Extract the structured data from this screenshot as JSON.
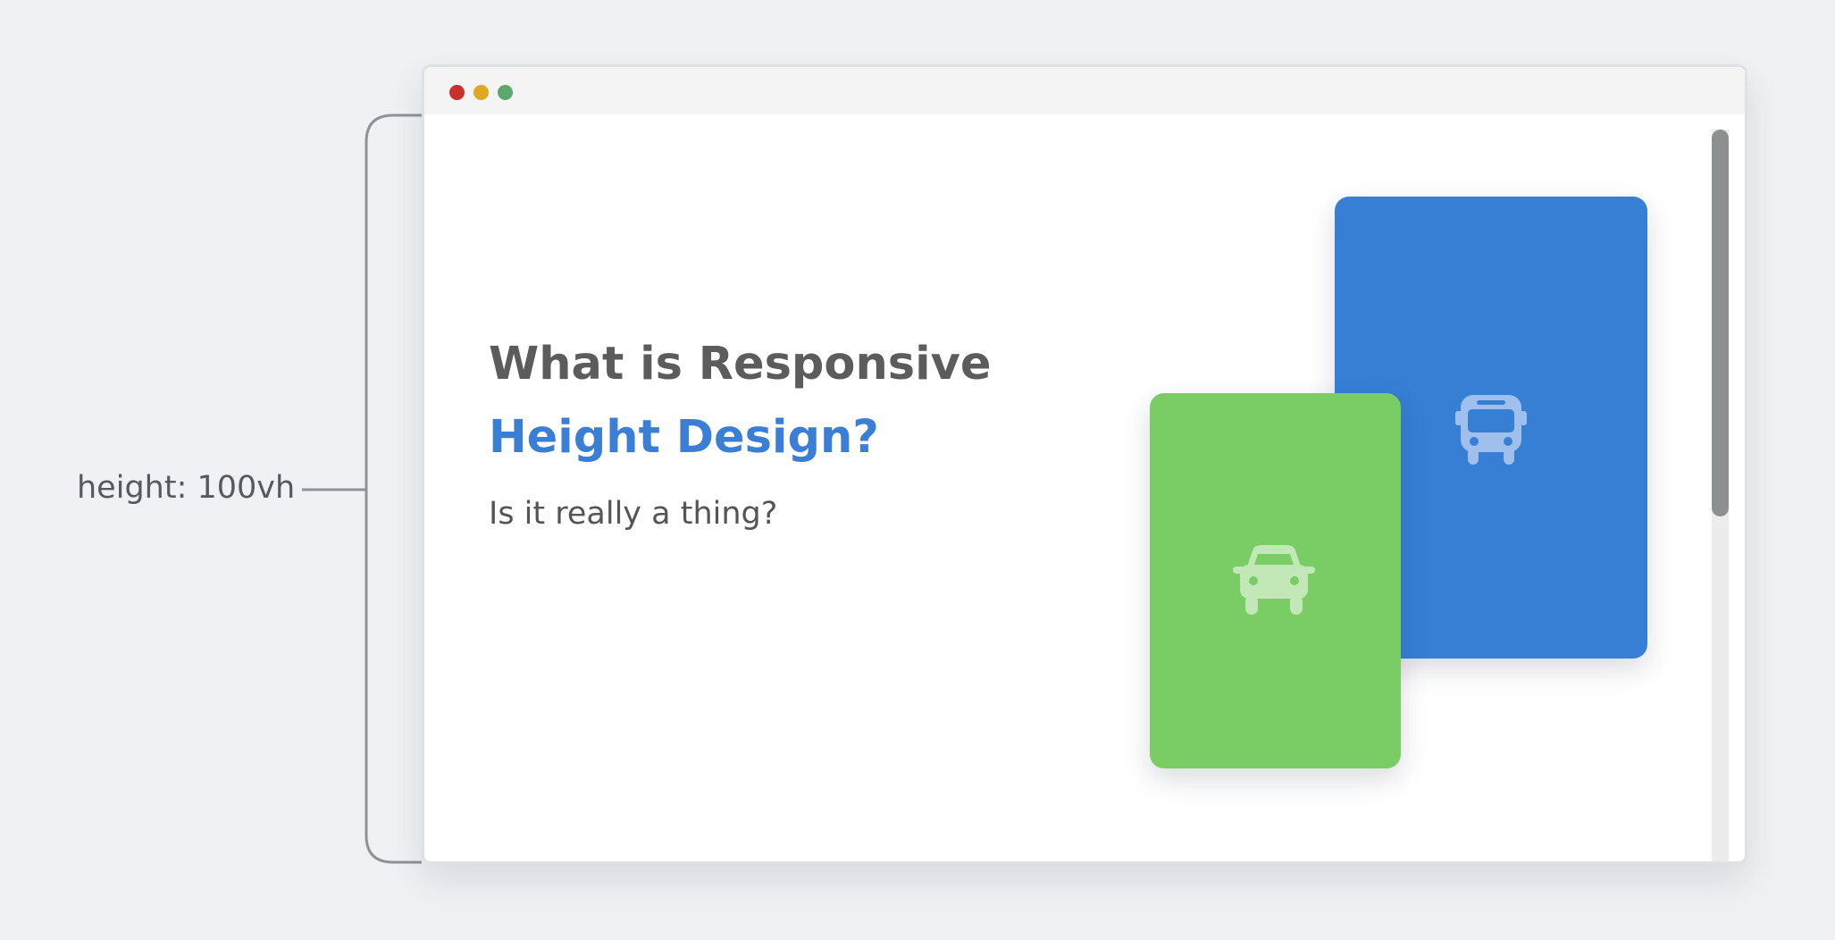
{
  "annotation": {
    "label": "height: 100vh"
  },
  "window": {
    "controls": {
      "close_color": "#c9302c",
      "minimize_color": "#e0a722",
      "maximize_color": "#5aa86a"
    }
  },
  "hero": {
    "title_line_1": "What is Responsive",
    "title_line_2": "Height Design?",
    "subtitle": "Is it really a thing?"
  },
  "cards": [
    {
      "color": "#367fd5",
      "icon": "bus-icon"
    },
    {
      "color": "#79cd64",
      "icon": "car-icon"
    }
  ],
  "colors": {
    "heading": "#5c5c5c",
    "accent": "#3a7fd5",
    "background": "#f0f1f4"
  }
}
